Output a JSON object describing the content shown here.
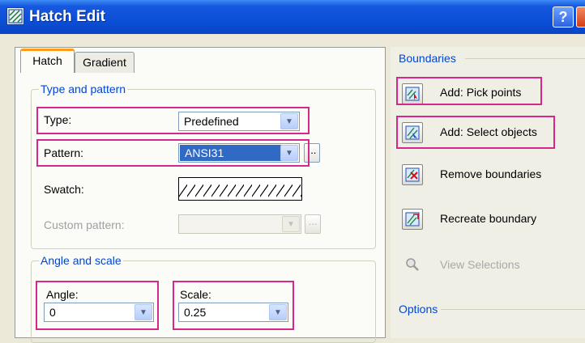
{
  "window": {
    "title": "Hatch Edit",
    "help_label": "?"
  },
  "tabs": {
    "hatch": "Hatch",
    "gradient": "Gradient"
  },
  "type_pattern": {
    "legend": "Type and pattern",
    "type_label": "Type:",
    "type_value": "Predefined",
    "pattern_label": "Pattern:",
    "pattern_value": "ANSI31",
    "swatch_label": "Swatch:",
    "custom_label": "Custom pattern:",
    "custom_value": "",
    "ellipsis": "..."
  },
  "angle_scale": {
    "legend": "Angle and scale",
    "angle_label": "Angle:",
    "angle_value": "0",
    "scale_label": "Scale:",
    "scale_value": "0.25"
  },
  "boundaries": {
    "legend": "Boundaries",
    "add_pick": "Add: Pick points",
    "add_select": "Add: Select objects",
    "remove": "Remove boundaries",
    "recreate": "Recreate boundary",
    "view": "View Selections"
  },
  "options": {
    "legend": "Options"
  },
  "colors": {
    "titlebar": "#0b4fd8",
    "group_legend": "#0046d5",
    "highlight": "#d6278a",
    "selected": "#316ac5",
    "active_tab_accent": "#ff9a1a"
  },
  "icons": {
    "title": "hatch-edit-icon",
    "pick_points": "pick-points-icon",
    "select_objects": "select-objects-icon",
    "remove_boundaries": "remove-boundaries-icon",
    "recreate_boundary": "recreate-boundary-icon",
    "view_selections": "magnifier-icon"
  }
}
